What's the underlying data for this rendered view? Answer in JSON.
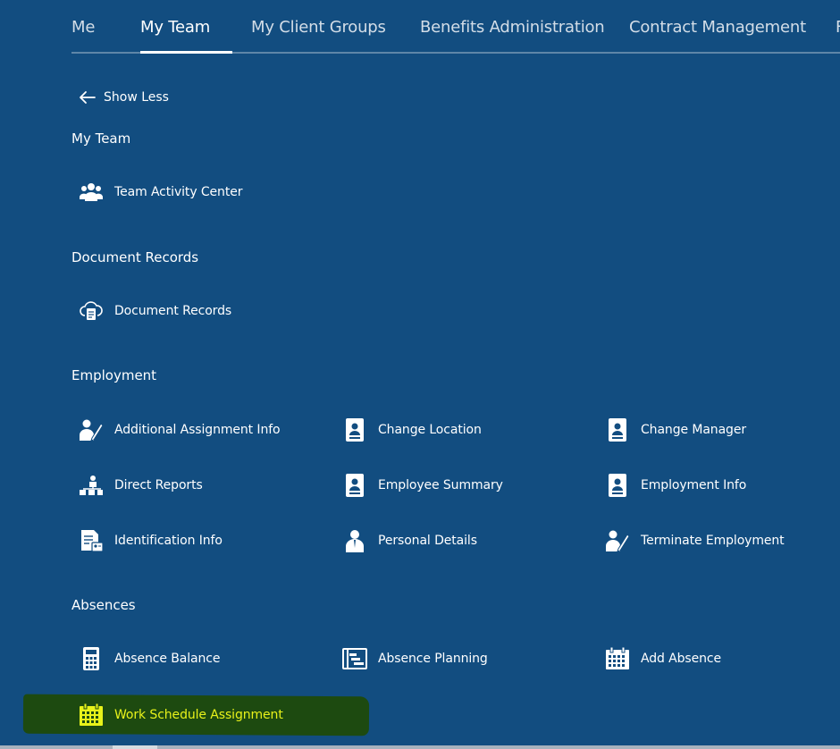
{
  "nav": {
    "tabs": [
      {
        "label": "Me"
      },
      {
        "label": "My Team"
      },
      {
        "label": "My Client Groups"
      },
      {
        "label": "Benefits Administration"
      },
      {
        "label": "Contract Management"
      },
      {
        "label": "F"
      }
    ],
    "active_index": 1
  },
  "show_less": "Show Less",
  "sections": {
    "my_team": {
      "title": "My Team",
      "items": [
        {
          "label": "Team Activity Center",
          "icon": "team-icon"
        }
      ]
    },
    "document_records": {
      "title": "Document Records",
      "items": [
        {
          "label": "Document Records",
          "icon": "cloud-document-icon"
        }
      ]
    },
    "employment": {
      "title": "Employment",
      "items": [
        {
          "label": "Additional Assignment Info",
          "icon": "person-edit-icon"
        },
        {
          "label": "Change Location",
          "icon": "id-badge-icon"
        },
        {
          "label": "Change Manager",
          "icon": "id-badge-icon"
        },
        {
          "label": "Direct Reports",
          "icon": "org-chart-icon"
        },
        {
          "label": "Employee Summary",
          "icon": "id-badge-icon"
        },
        {
          "label": "Employment Info",
          "icon": "id-badge-icon"
        },
        {
          "label": "Identification Info",
          "icon": "id-document-icon"
        },
        {
          "label": "Personal Details",
          "icon": "person-icon"
        },
        {
          "label": "Terminate Employment",
          "icon": "person-edit-icon"
        }
      ]
    },
    "absences": {
      "title": "Absences",
      "items": [
        {
          "label": "Absence Balance",
          "icon": "calculator-icon"
        },
        {
          "label": "Absence Planning",
          "icon": "planning-chart-icon"
        },
        {
          "label": "Add Absence",
          "icon": "calendar-icon"
        },
        {
          "label": "Work Schedule Assignment",
          "icon": "calendar-icon",
          "highlighted": true
        }
      ]
    }
  },
  "colors": {
    "background": "#124d80",
    "highlight_background": "#1d4a10",
    "highlight_text": "#e8f21a",
    "text": "#ffffff"
  }
}
